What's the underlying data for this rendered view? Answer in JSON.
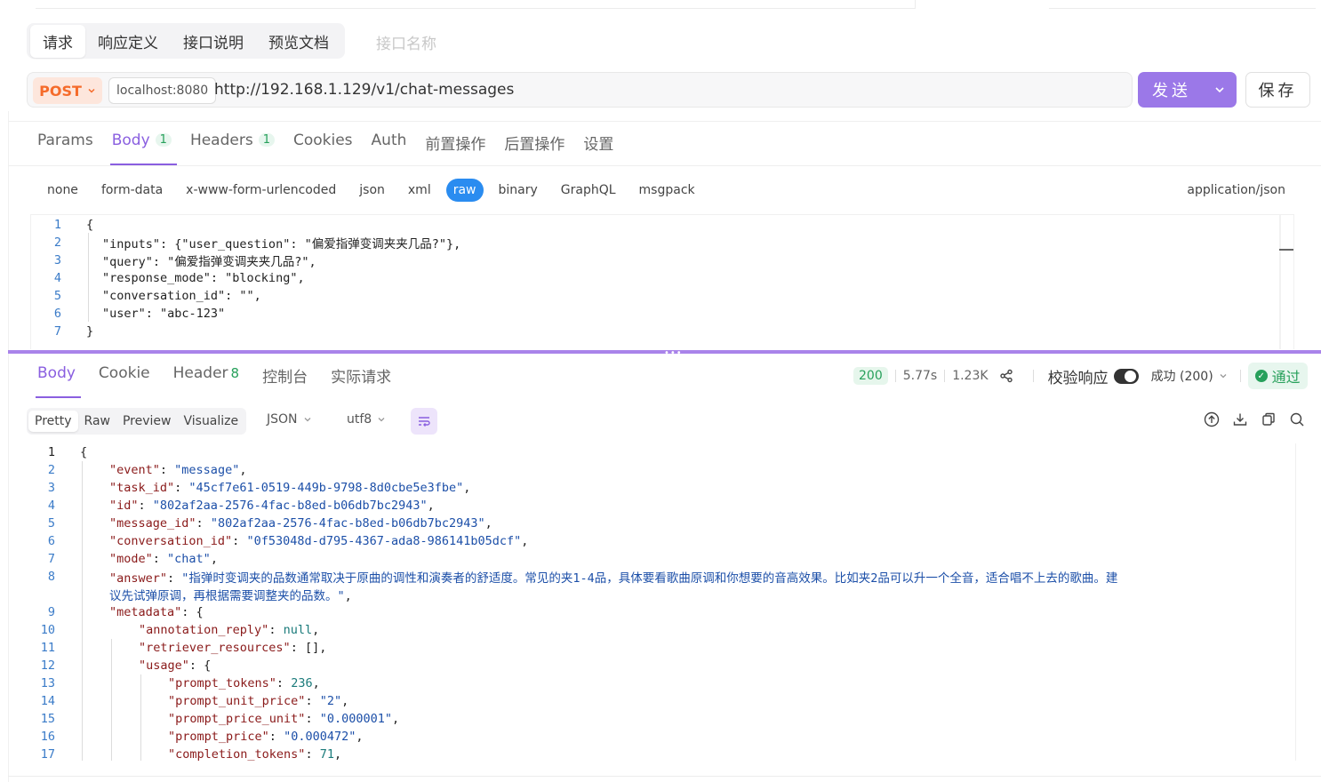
{
  "request_tabs": [
    "请求",
    "响应定义",
    "接口说明",
    "预览文档"
  ],
  "interface_name_placeholder": "接口名称",
  "method": "POST",
  "environment": "localhost:8080",
  "url": "http://192.168.1.129/v1/chat-messages",
  "send_label": "发送",
  "save_label": "保存",
  "param_tabs": [
    {
      "label": "Params"
    },
    {
      "label": "Body",
      "badge": "1"
    },
    {
      "label": "Headers",
      "badge": "1"
    },
    {
      "label": "Cookies"
    },
    {
      "label": "Auth"
    },
    {
      "label": "前置操作"
    },
    {
      "label": "后置操作"
    },
    {
      "label": "设置"
    }
  ],
  "body_types": [
    "none",
    "form-data",
    "x-www-form-urlencoded",
    "json",
    "xml",
    "raw",
    "binary",
    "GraphQL",
    "msgpack"
  ],
  "active_body_type": "raw",
  "content_type": "application/json",
  "request_body": [
    "{",
    "\"inputs\": {\"user_question\": \"偏爱指弹变调夹夹几品?\"},",
    "\"query\": \"偏爱指弹变调夹夹几品?\",",
    "\"response_mode\": \"blocking\",",
    "\"conversation_id\": \"\",",
    "\"user\": \"abc-123\"",
    "}"
  ],
  "response_tabs": [
    {
      "label": "Body"
    },
    {
      "label": "Cookie"
    },
    {
      "label": "Header",
      "count": "8"
    },
    {
      "label": "控制台"
    },
    {
      "label": "实际请求"
    }
  ],
  "status": {
    "code": "200",
    "time": "5.77s",
    "size": "1.23K",
    "validate_label": "校验响应",
    "result_select": "成功 (200)",
    "pass_label": "通过"
  },
  "view_options": [
    "Pretty",
    "Raw",
    "Preview",
    "Visualize"
  ],
  "format_select": "JSON",
  "encoding_select": "utf8",
  "response_lines": [
    {
      "n": "1",
      "indent": 0,
      "parts": [
        [
          "p",
          "{"
        ]
      ]
    },
    {
      "n": "2",
      "indent": 1,
      "parts": [
        [
          "k",
          "\"event\""
        ],
        [
          "p",
          ": "
        ],
        [
          "s",
          "\"message\""
        ],
        [
          "p",
          ","
        ]
      ]
    },
    {
      "n": "3",
      "indent": 1,
      "parts": [
        [
          "k",
          "\"task_id\""
        ],
        [
          "p",
          ": "
        ],
        [
          "s",
          "\"45cf7e61-0519-449b-9798-8d0cbe5e3fbe\""
        ],
        [
          "p",
          ","
        ]
      ]
    },
    {
      "n": "4",
      "indent": 1,
      "parts": [
        [
          "k",
          "\"id\""
        ],
        [
          "p",
          ": "
        ],
        [
          "s",
          "\"802af2aa-2576-4fac-b8ed-b06db7bc2943\""
        ],
        [
          "p",
          ","
        ]
      ]
    },
    {
      "n": "5",
      "indent": 1,
      "parts": [
        [
          "k",
          "\"message_id\""
        ],
        [
          "p",
          ": "
        ],
        [
          "s",
          "\"802af2aa-2576-4fac-b8ed-b06db7bc2943\""
        ],
        [
          "p",
          ","
        ]
      ]
    },
    {
      "n": "6",
      "indent": 1,
      "parts": [
        [
          "k",
          "\"conversation_id\""
        ],
        [
          "p",
          ": "
        ],
        [
          "s",
          "\"0f53048d-d795-4367-ada8-986141b05dcf\""
        ],
        [
          "p",
          ","
        ]
      ]
    },
    {
      "n": "7",
      "indent": 1,
      "parts": [
        [
          "k",
          "\"mode\""
        ],
        [
          "p",
          ": "
        ],
        [
          "s",
          "\"chat\""
        ],
        [
          "p",
          ","
        ]
      ]
    },
    {
      "n": "8",
      "indent": 1,
      "parts": [
        [
          "k",
          "\"answer\""
        ],
        [
          "p",
          ": "
        ],
        [
          "s",
          "\"指弹时变调夹的品数通常取决于原曲的调性和演奏者的舒适度。常见的夹1-4品，具体要看歌曲原调和你想要的音高效果。比如夹2品可以升一个全音，适合唱不上去的歌曲。建"
        ]
      ]
    },
    {
      "n": "",
      "indent": 1,
      "parts": [
        [
          "s",
          "议先试弹原调，再根据需要调整夹的品数。\""
        ],
        [
          "p",
          ","
        ]
      ]
    },
    {
      "n": "9",
      "indent": 1,
      "parts": [
        [
          "k",
          "\"metadata\""
        ],
        [
          "p",
          ": {"
        ]
      ]
    },
    {
      "n": "10",
      "indent": 2,
      "parts": [
        [
          "k",
          "\"annotation_reply\""
        ],
        [
          "p",
          ": "
        ],
        [
          "n",
          "null"
        ],
        [
          "p",
          ","
        ]
      ]
    },
    {
      "n": "11",
      "indent": 2,
      "parts": [
        [
          "k",
          "\"retriever_resources\""
        ],
        [
          "p",
          ": [],"
        ]
      ]
    },
    {
      "n": "12",
      "indent": 2,
      "parts": [
        [
          "k",
          "\"usage\""
        ],
        [
          "p",
          ": {"
        ]
      ]
    },
    {
      "n": "13",
      "indent": 3,
      "parts": [
        [
          "k",
          "\"prompt_tokens\""
        ],
        [
          "p",
          ": "
        ],
        [
          "n",
          "236"
        ],
        [
          "p",
          ","
        ]
      ]
    },
    {
      "n": "14",
      "indent": 3,
      "parts": [
        [
          "k",
          "\"prompt_unit_price\""
        ],
        [
          "p",
          ": "
        ],
        [
          "s",
          "\"2\""
        ],
        [
          "p",
          ","
        ]
      ]
    },
    {
      "n": "15",
      "indent": 3,
      "parts": [
        [
          "k",
          "\"prompt_price_unit\""
        ],
        [
          "p",
          ": "
        ],
        [
          "s",
          "\"0.000001\""
        ],
        [
          "p",
          ","
        ]
      ]
    },
    {
      "n": "16",
      "indent": 3,
      "parts": [
        [
          "k",
          "\"prompt_price\""
        ],
        [
          "p",
          ": "
        ],
        [
          "s",
          "\"0.000472\""
        ],
        [
          "p",
          ","
        ]
      ]
    },
    {
      "n": "17",
      "indent": 3,
      "parts": [
        [
          "k",
          "\"completion_tokens\""
        ],
        [
          "p",
          ": "
        ],
        [
          "n",
          "71"
        ],
        [
          "p",
          ","
        ]
      ]
    }
  ],
  "colors": {
    "accent": "#9b78e8",
    "method": "#f56b2a",
    "success": "#27a05b",
    "raw_active": "#2a8cf0"
  },
  "icons": [
    "chevron-down-icon",
    "share-icon",
    "check-circle-icon",
    "wrap-lines-icon",
    "upload-icon",
    "download-icon",
    "copy-icon",
    "search-icon"
  ]
}
